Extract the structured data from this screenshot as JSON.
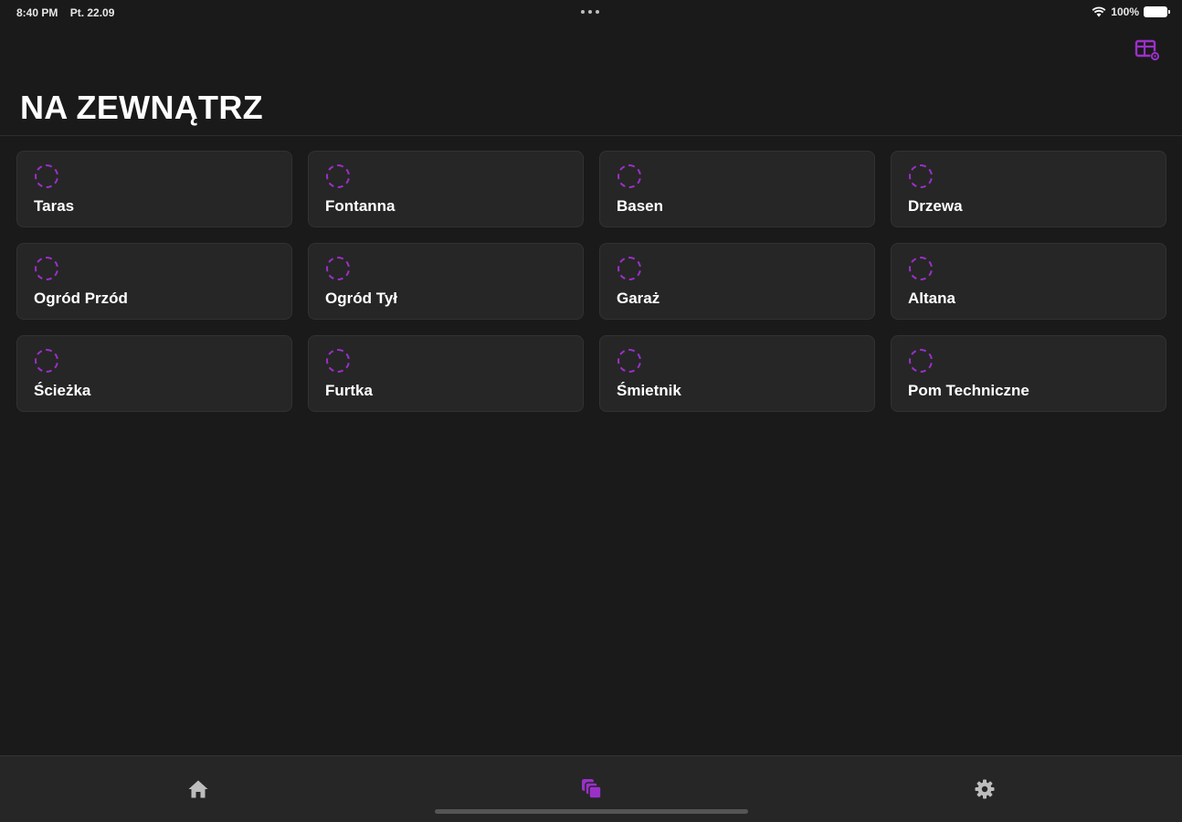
{
  "status_bar": {
    "time": "8:40 PM",
    "date": "Pt. 22.09",
    "battery": "100%"
  },
  "page": {
    "title": "NA ZEWNĄTRZ"
  },
  "rooms": [
    {
      "label": "Taras"
    },
    {
      "label": "Fontanna"
    },
    {
      "label": "Basen"
    },
    {
      "label": "Drzewa"
    },
    {
      "label": "Ogród Przód"
    },
    {
      "label": "Ogród Tył"
    },
    {
      "label": "Garaż"
    },
    {
      "label": "Altana"
    },
    {
      "label": "Ścieżka"
    },
    {
      "label": "Furtka"
    },
    {
      "label": "Śmietnik"
    },
    {
      "label": "Pom Techniczne"
    }
  ],
  "tabs": [
    {
      "icon": "home-icon",
      "active": false
    },
    {
      "icon": "rooms-icon",
      "active": true
    },
    {
      "icon": "gear-icon",
      "active": false
    }
  ],
  "colors": {
    "background": "#1a1a1a",
    "card": "#262626",
    "accent": "#9b30c9",
    "inactive_icon": "#bdbdbd"
  }
}
